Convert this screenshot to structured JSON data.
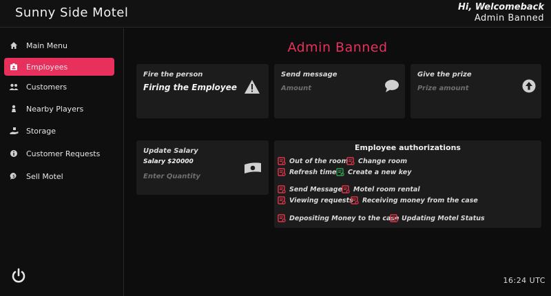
{
  "header": {
    "app_title": "Sunny Side Motel",
    "greeting": "Hi, Welcomeback",
    "user_name": "Admin Banned"
  },
  "sidebar": {
    "items": [
      {
        "label": "Main Menu",
        "icon": "home-icon",
        "active": false
      },
      {
        "label": "Employees",
        "icon": "id-badge-icon",
        "active": true
      },
      {
        "label": "Customers",
        "icon": "users-icon",
        "active": false
      },
      {
        "label": "Nearby Players",
        "icon": "person-icon",
        "active": false
      },
      {
        "label": "Storage",
        "icon": "hand-box-icon",
        "active": false
      },
      {
        "label": "Customer Requests",
        "icon": "info-icon",
        "active": false
      },
      {
        "label": "Sell Motel",
        "icon": "money-bubble-icon",
        "active": false
      }
    ],
    "power_icon": "power-icon"
  },
  "main": {
    "page_title": "Admin Banned",
    "fire_card": {
      "caption": "Fire the person",
      "action": "Firing the Employee",
      "icon": "warning-icon"
    },
    "message_card": {
      "caption": "Send message",
      "placeholder": "Amount",
      "icon": "chat-bubble-icon"
    },
    "prize_card": {
      "caption": "Give the prize",
      "placeholder": "Prize amount",
      "icon": "arrow-up-circle-icon"
    },
    "salary_card": {
      "caption": "Update Salary",
      "salary": "Salary $20000",
      "placeholder": "Enter Quantity",
      "icon": "banknote-icon"
    },
    "authorizations": {
      "title": "Employee authorizations",
      "permissions": [
        {
          "label": "Out of the room",
          "granted": false
        },
        {
          "label": "Change room",
          "granted": false
        },
        {
          "label": "Refresh time",
          "granted": false
        },
        {
          "label": "Create a new key",
          "granted": true
        },
        {
          "label": "Send Message",
          "granted": false
        },
        {
          "label": "Motel room rental",
          "granted": false
        },
        {
          "label": "Viewing requests",
          "granted": false
        },
        {
          "label": "Receiving money from the case",
          "granted": false
        },
        {
          "label": "Depositing Money to the case",
          "granted": false
        },
        {
          "label": "Updating Motel Status",
          "granted": false
        }
      ]
    }
  },
  "status": {
    "clock": "16:24 UTC"
  },
  "colors": {
    "accent": "#e8305c",
    "denied": "#e0354a",
    "granted": "#2e9e4f",
    "card_bg": "#1c1c1c"
  }
}
